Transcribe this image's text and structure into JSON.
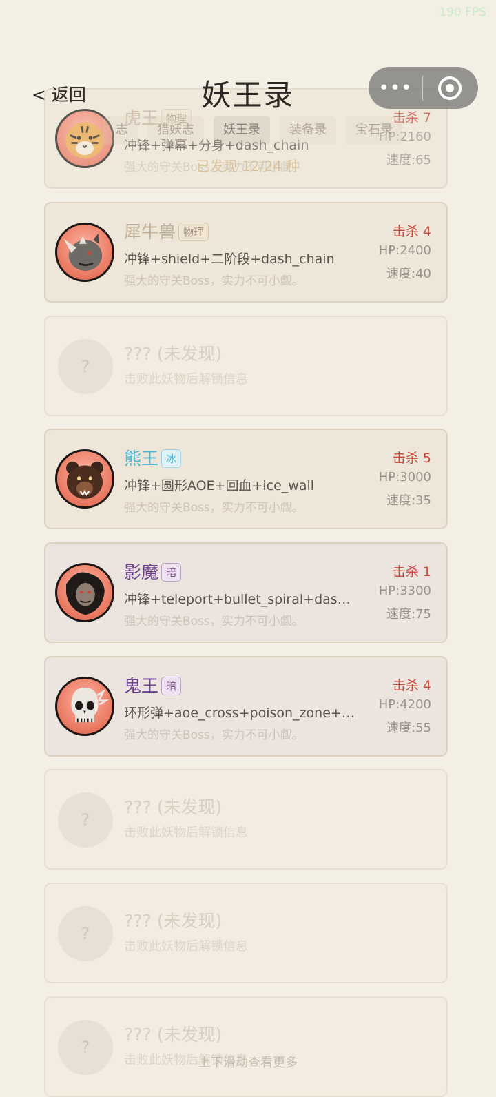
{
  "fps": "190 FPS",
  "nav": {
    "back": "< 返回",
    "title": "妖王录",
    "more_glyph": "•••"
  },
  "tabs": [
    "志",
    "猎妖志",
    "妖王录",
    "装备录",
    "宝石录"
  ],
  "discovered": "已发现 12/24 种",
  "bosses": [
    {
      "name": "虎王",
      "type": "物理",
      "skills": "冲锋+弹幕+分身+dash_chain",
      "desc": "强大的守关Boss，实力不可小觑。",
      "kills": "击杀 7",
      "hp": "HP:2160",
      "speed": "速度:65",
      "avatar": "tiger-icon"
    },
    {
      "name": "犀牛兽",
      "type": "物理",
      "skills": "冲锋+shield+二阶段+dash_chain",
      "desc": "强大的守关Boss，实力不可小觑。",
      "kills": "击杀 4",
      "hp": "HP:2400",
      "speed": "速度:40",
      "avatar": "rhino-icon"
    },
    {
      "name": "熊王",
      "type": "冰",
      "skills": "冲锋+圆形AOE+回血+ice_wall",
      "desc": "强大的守关Boss，实力不可小觑。",
      "kills": "击杀 5",
      "hp": "HP:3000",
      "speed": "速度:35",
      "avatar": "bear-icon"
    },
    {
      "name": "影魔",
      "type": "暗",
      "skills": "冲锋+teleport+bullet_spiral+dash_...",
      "desc": "强大的守关Boss，实力不可小觑。",
      "kills": "击杀 1",
      "hp": "HP:3300",
      "speed": "速度:75",
      "avatar": "shadow-demon-icon"
    },
    {
      "name": "鬼王",
      "type": "暗",
      "skills": "环形弹+aoe_cross+poison_zone+mi...",
      "desc": "强大的守关Boss，实力不可小觑。",
      "kills": "击杀 4",
      "hp": "HP:4200",
      "speed": "速度:55",
      "avatar": "skull-icon"
    }
  ],
  "locked": {
    "title": "??? (未发现)",
    "sub": "击败此妖物后解锁信息",
    "avatar_glyph": "?"
  },
  "scroll_hint": "上下滑动查看更多",
  "colors": {
    "background": "#f4efe4",
    "kill_red": "#c9493d",
    "ice": "#4db7d4",
    "dark": "#6b3f8e",
    "gold": "#d9c49e"
  }
}
